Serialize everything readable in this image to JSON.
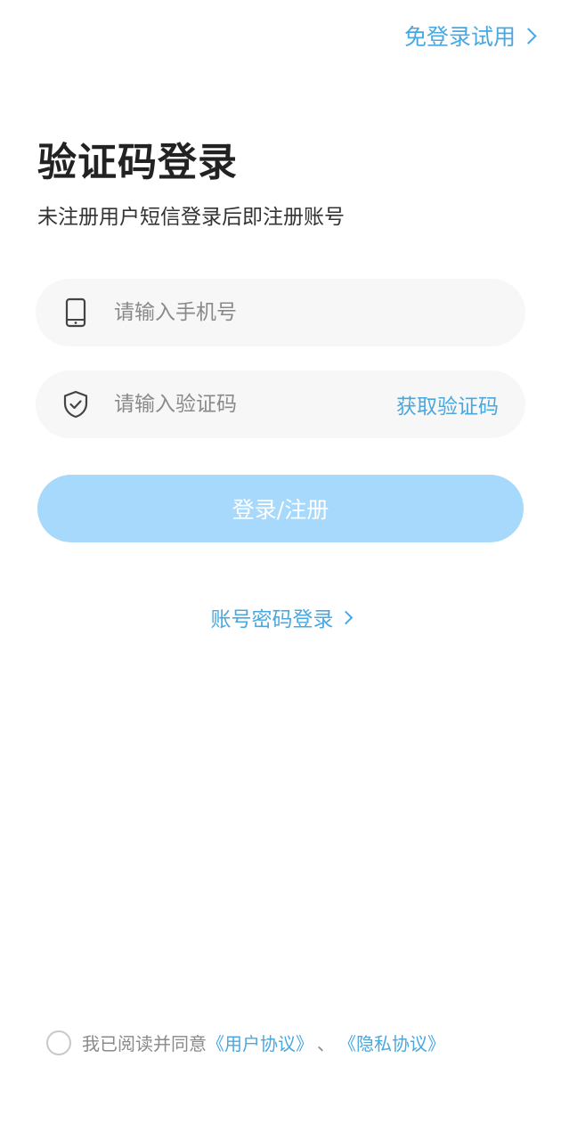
{
  "header": {
    "skip_login_label": "免登录试用"
  },
  "main": {
    "title": "验证码登录",
    "subtitle": "未注册用户短信登录后即注册账号",
    "phone_input": {
      "placeholder": "请输入手机号",
      "value": "",
      "icon": "smartphone-icon"
    },
    "code_input": {
      "placeholder": "请输入验证码",
      "value": "",
      "icon": "shield-check-icon",
      "get_code_label": "获取验证码"
    },
    "login_button_label": "登录/注册",
    "password_login_label": "账号密码登录"
  },
  "footer": {
    "agreement_prefix": "我已阅读并同意",
    "user_agreement": "《用户协议》",
    "separator": "、",
    "privacy_agreement": "《隐私协议》"
  },
  "colors": {
    "accent": "#4aa8e0",
    "button_disabled": "#a6d9fb",
    "field_bg": "#f7f7f7"
  }
}
